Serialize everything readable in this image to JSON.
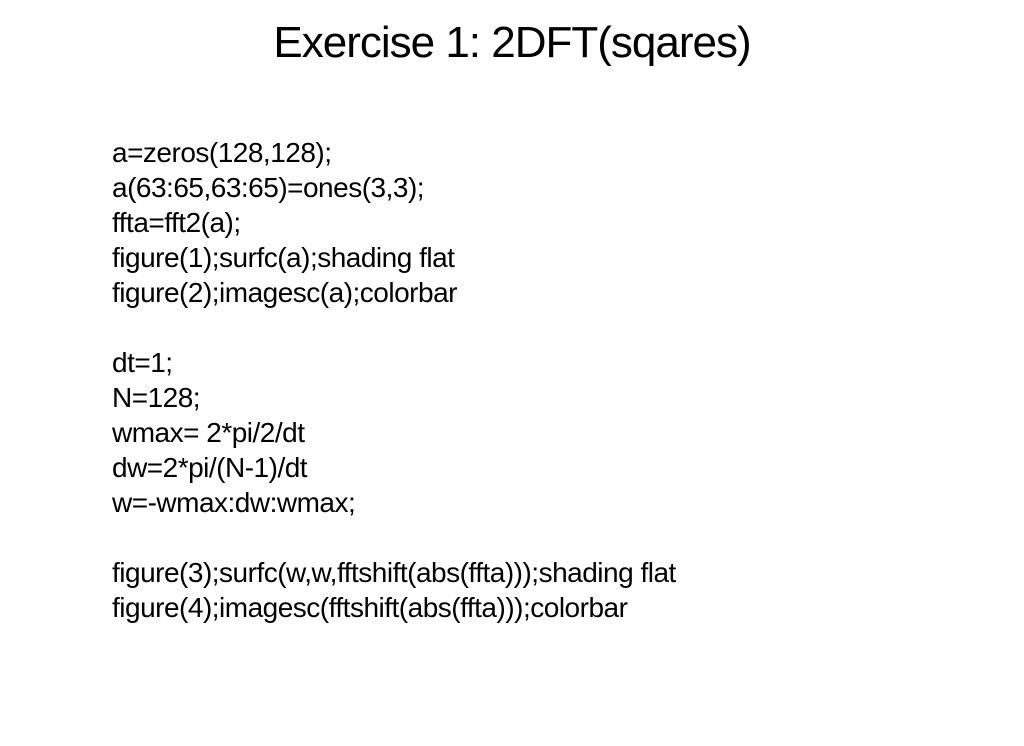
{
  "title": "Exercise 1: 2DFT(sqares)",
  "code": {
    "block1": {
      "line1": "a=zeros(128,128);",
      "line2": "a(63:65,63:65)=ones(3,3);",
      "line3": "ffta=fft2(a);",
      "line4": "figure(1);surfc(a);shading flat",
      "line5": "figure(2);imagesc(a);colorbar"
    },
    "block2": {
      "line1": "dt=1;",
      "line2": "N=128;",
      "line3": "wmax= 2*pi/2/dt",
      "line4": "dw=2*pi/(N-1)/dt",
      "line5": "w=-wmax:dw:wmax;"
    },
    "block3": {
      "line1": "figure(3);surfc(w,w,fftshift(abs(ffta)));shading flat",
      "line2": "figure(4);imagesc(fftshift(abs(ffta)));colorbar"
    }
  }
}
